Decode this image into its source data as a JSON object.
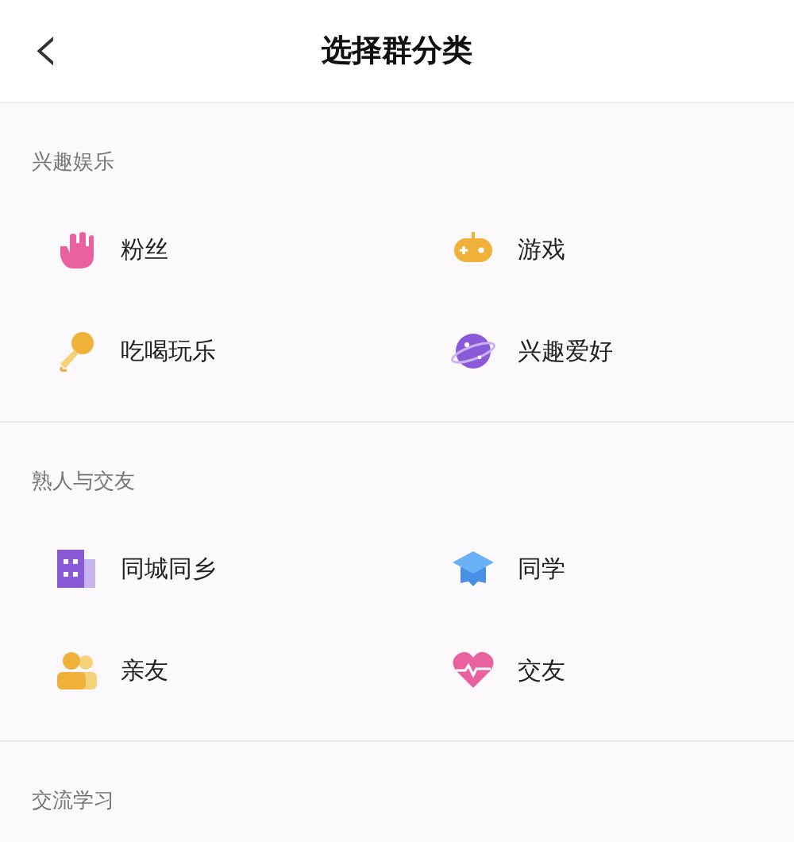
{
  "header": {
    "back_icon": "‹",
    "title": "选择群分类"
  },
  "sections": [
    {
      "title": "兴趣娱乐",
      "items": [
        {
          "label": "粉丝",
          "kind": "hand"
        },
        {
          "label": "游戏",
          "kind": "gamepad"
        },
        {
          "label": "吃喝玩乐",
          "kind": "microphone"
        },
        {
          "label": "兴趣爱好",
          "kind": "planet"
        }
      ]
    },
    {
      "title": "熟人与交友",
      "items": [
        {
          "label": "同城同乡",
          "kind": "building"
        },
        {
          "label": "同学",
          "kind": "cap"
        },
        {
          "label": "亲友",
          "kind": "people"
        },
        {
          "label": "交友",
          "kind": "heart"
        }
      ]
    },
    {
      "title": "交流学习"
    }
  ]
}
